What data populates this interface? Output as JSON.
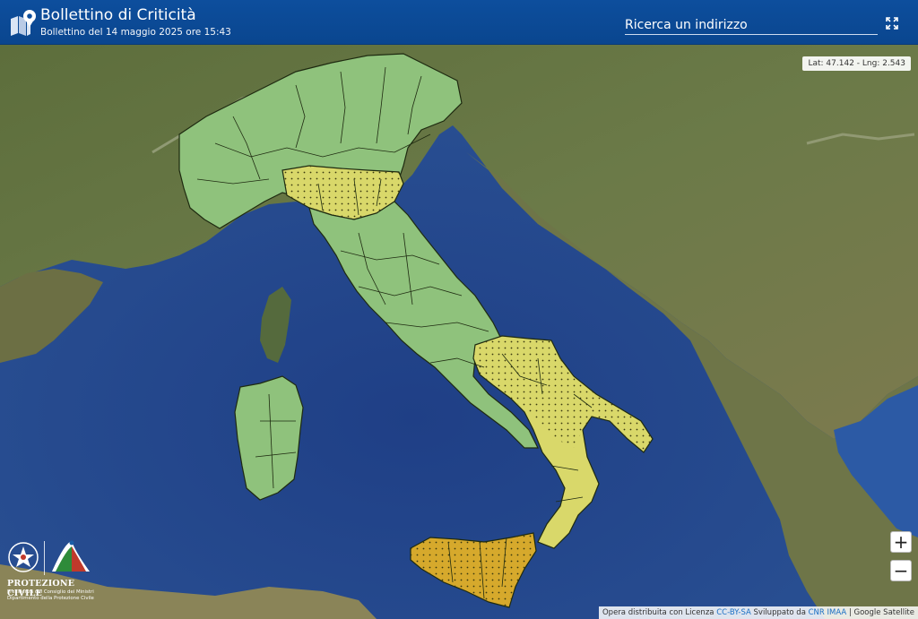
{
  "header": {
    "title": "Bollettino di Criticità",
    "subtitle": "Bollettino del 14 maggio 2025 ore 15:43",
    "search_placeholder": "Ricerca un indirizzo"
  },
  "map": {
    "coords_readout": "Lat: 47.142 - Lng: 2.543",
    "zoom_in_label": "+",
    "zoom_out_label": "−",
    "alert_colors": {
      "green": "#8fc27c",
      "yellow": "#d9d86a",
      "orange": "#d6a92c"
    },
    "alert_zones": [
      {
        "region": "Nord Italia",
        "level": "green"
      },
      {
        "region": "Emilia-Romagna",
        "level": "yellow"
      },
      {
        "region": "Centro Italia",
        "level": "green"
      },
      {
        "region": "Puglia, Basilicata e Calabria",
        "level": "yellow"
      },
      {
        "region": "Sicilia",
        "level": "orange"
      },
      {
        "region": "Sardegna",
        "level": "green"
      }
    ]
  },
  "footer": {
    "org_name": "PROTEZIONE CIVILE",
    "org_sub1": "Presidenza del Consiglio dei Ministri",
    "org_sub2": "Dipartimento della Protezione Civile",
    "attribution_prefix": "Opera distribuita con Licenza",
    "attribution_license": "CC-BY-SA",
    "attribution_mid": "Sviluppato da",
    "attribution_dev": "CNR IMAA",
    "attribution_suffix": "| Google Satellite"
  }
}
